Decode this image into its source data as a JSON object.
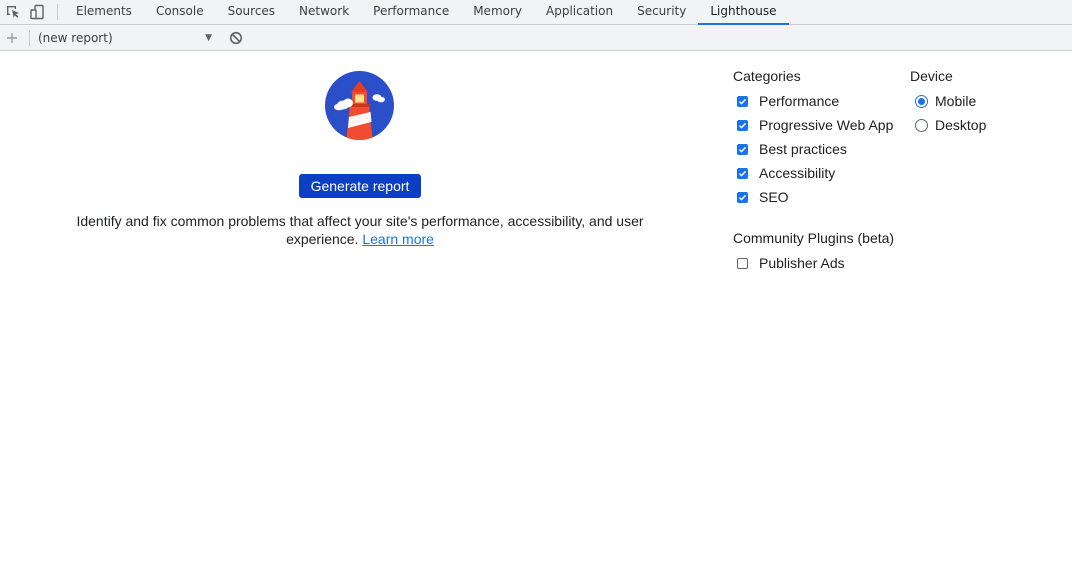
{
  "tabs": [
    {
      "label": "Elements",
      "active": false
    },
    {
      "label": "Console",
      "active": false
    },
    {
      "label": "Sources",
      "active": false
    },
    {
      "label": "Network",
      "active": false
    },
    {
      "label": "Performance",
      "active": false
    },
    {
      "label": "Memory",
      "active": false
    },
    {
      "label": "Application",
      "active": false
    },
    {
      "label": "Security",
      "active": false
    },
    {
      "label": "Lighthouse",
      "active": true
    }
  ],
  "toolbar": {
    "icons": [
      "inspect-element-icon",
      "device-toolbar-icon"
    ],
    "add_icon": "plus-icon",
    "report_select": "(new report)",
    "clear_icon": "clear-icon"
  },
  "main": {
    "logo": "lighthouse-logo",
    "generate_label": "Generate report",
    "intro_text": "Identify and fix common problems that affect your site's performance, accessibility, and user experience.",
    "learn_more": "Learn more"
  },
  "categories": {
    "title": "Categories",
    "items": [
      {
        "label": "Performance",
        "checked": true
      },
      {
        "label": "Progressive Web App",
        "checked": true
      },
      {
        "label": "Best practices",
        "checked": true
      },
      {
        "label": "Accessibility",
        "checked": true
      },
      {
        "label": "SEO",
        "checked": true
      }
    ]
  },
  "device": {
    "title": "Device",
    "items": [
      {
        "label": "Mobile",
        "selected": true
      },
      {
        "label": "Desktop",
        "selected": false
      }
    ]
  },
  "plugins": {
    "title": "Community Plugins (beta)",
    "items": [
      {
        "label": "Publisher Ads",
        "checked": false
      }
    ]
  },
  "colors": {
    "accent": "#1a73e8",
    "button": "#0b3fc4",
    "logo_blue": "#2a4fc9",
    "logo_red": "#f44b30"
  }
}
